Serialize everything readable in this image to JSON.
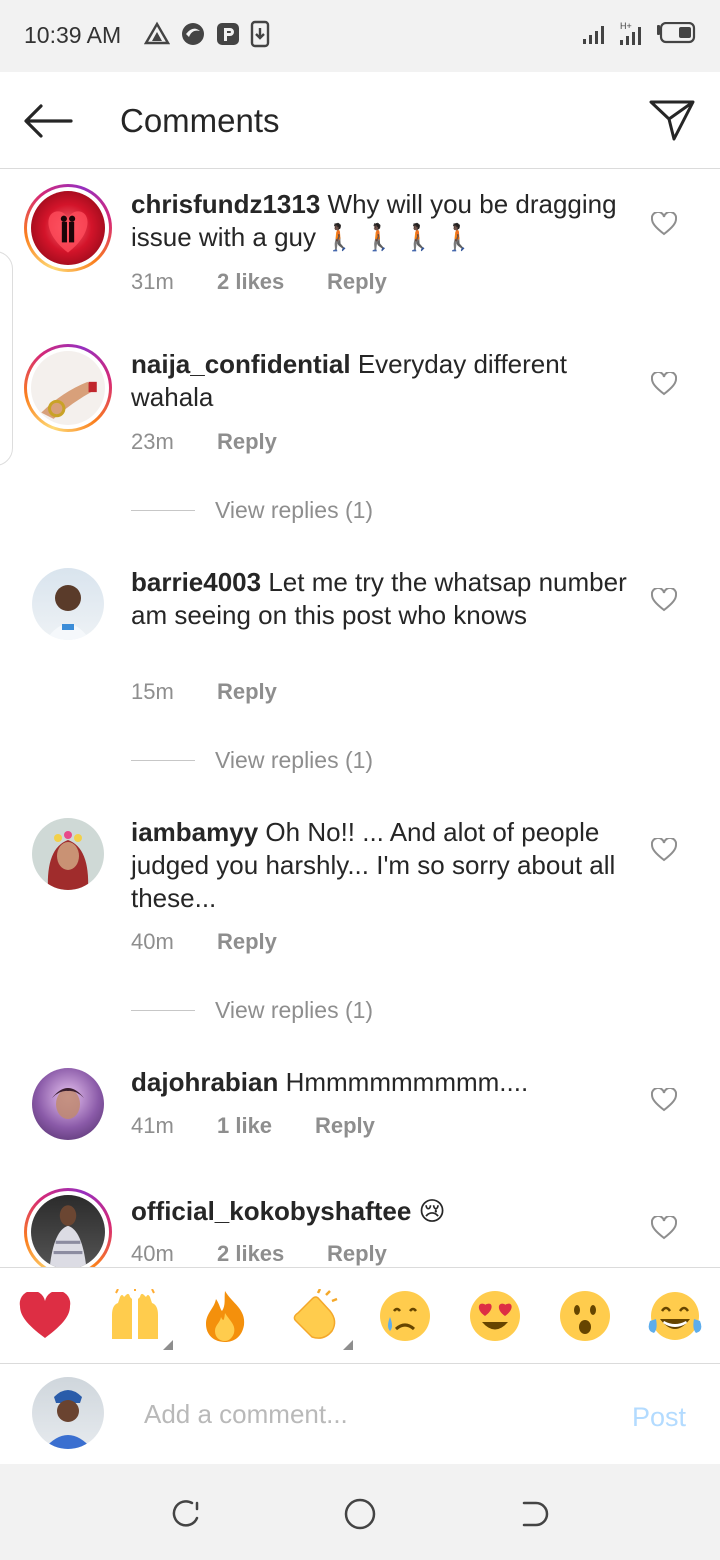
{
  "status_bar": {
    "time": "10:39 AM"
  },
  "header": {
    "title": "Comments"
  },
  "comments": [
    {
      "username": "chrisfundz1313",
      "text": "Why will you be dragging issue with a guy 🚶🏿 🚶🏿 🚶🏿 🚶🏿",
      "time": "31m",
      "likes": "2 likes",
      "reply": "Reply"
    },
    {
      "username": "naija_confidential",
      "text": "Everyday different wahala",
      "time": "23m",
      "likes": "",
      "reply": "Reply",
      "view_replies": "View replies (1)"
    },
    {
      "username": "barrie4003",
      "text": "Let me try the whatsap number am seeing on this post who knows",
      "time": "15m",
      "likes": "",
      "reply": "Reply",
      "view_replies": "View replies (1)"
    },
    {
      "username": "iambamyy",
      "text": "Oh No!! ... And alot of people judged you harshly... I'm so sorry about all these...",
      "time": "40m",
      "likes": "",
      "reply": "Reply",
      "view_replies": "View replies (1)"
    },
    {
      "username": "dajohrabian",
      "text": "Hmmmmmmmmm....",
      "time": "41m",
      "likes": "1 like",
      "reply": "Reply"
    },
    {
      "username": "official_kokobyshaftee",
      "text": "😢",
      "time": "40m",
      "likes": "2 likes",
      "reply": "Reply"
    }
  ],
  "emoji_bar": [
    {
      "icon": "red-heart",
      "glyph": "❤️"
    },
    {
      "icon": "raising-hands",
      "glyph": "🙌"
    },
    {
      "icon": "fire",
      "glyph": "🔥"
    },
    {
      "icon": "clapping-hands",
      "glyph": "👏"
    },
    {
      "icon": "crying-face",
      "glyph": "😢"
    },
    {
      "icon": "heart-eyes",
      "glyph": "😍"
    },
    {
      "icon": "astonished-face",
      "glyph": "😮"
    },
    {
      "icon": "tears-of-joy",
      "glyph": "😂"
    }
  ],
  "composer": {
    "placeholder": "Add a comment...",
    "post_label": "Post"
  },
  "colors": {
    "post_disabled": "#b3dbff",
    "meta_gray": "#8e8e8e",
    "text": "#262626"
  }
}
